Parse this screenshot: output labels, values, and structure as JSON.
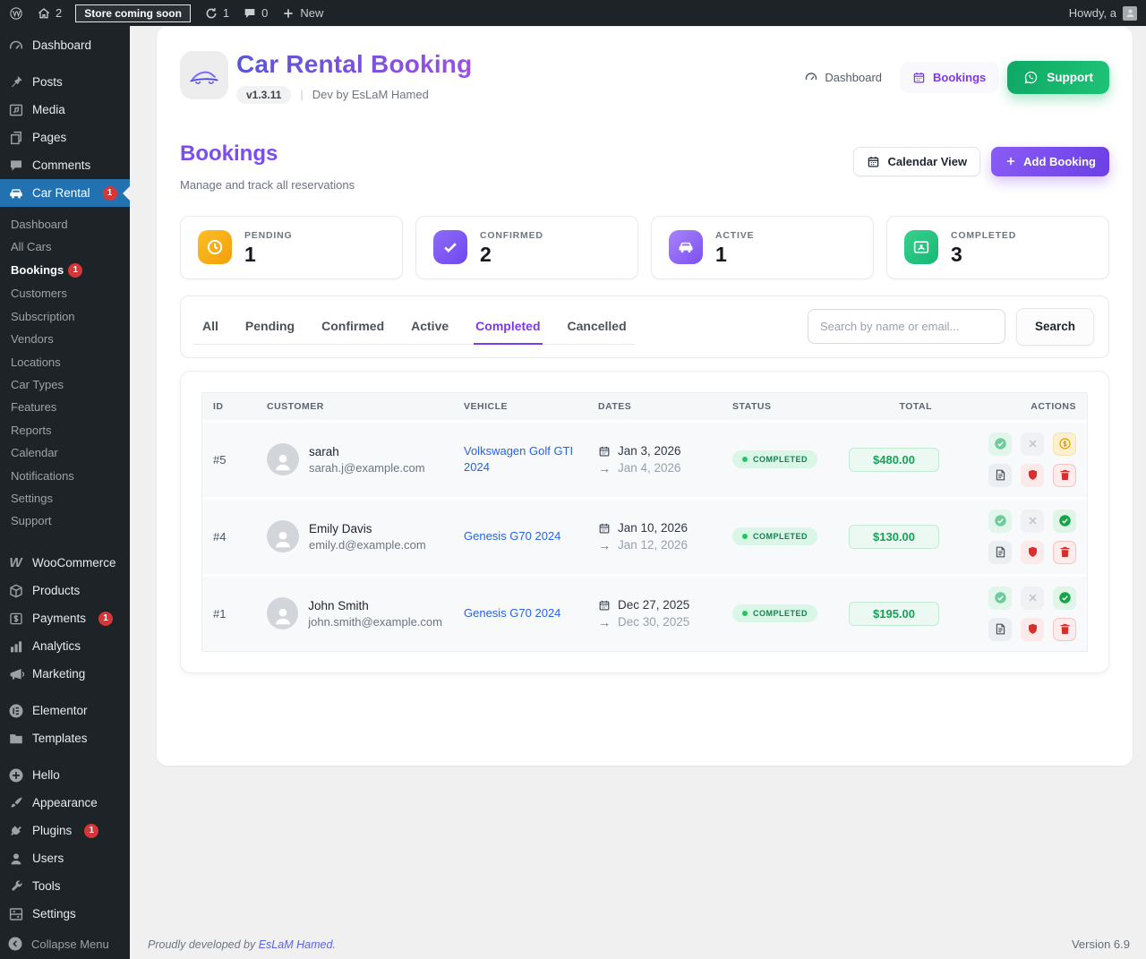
{
  "colors": {
    "accent_purple": "#7c3aed",
    "accent_green": "#12b76a",
    "wp_active_blue": "#2271b1",
    "badge_red": "#d63638",
    "status_completed_bg": "#d9f6e6",
    "status_completed_text": "#178050"
  },
  "admin_bar": {
    "home_count": "2",
    "site_status": "Store coming soon",
    "updates_count": "1",
    "comments_count": "0",
    "new_label": "New",
    "greeting": "Howdy, a"
  },
  "sidebar": {
    "items": [
      {
        "label": "Dashboard",
        "icon": "dashboard-icon"
      },
      {
        "label": "Posts",
        "icon": "pushpin-icon",
        "gap_before": true
      },
      {
        "label": "Media",
        "icon": "media-icon"
      },
      {
        "label": "Pages",
        "icon": "pages-icon"
      },
      {
        "label": "Comments",
        "icon": "comment-icon"
      },
      {
        "label": "Car Rental",
        "icon": "car-icon",
        "badge": "1",
        "active": true,
        "submenu": [
          {
            "label": "Dashboard"
          },
          {
            "label": "All Cars"
          },
          {
            "label": "Bookings",
            "badge": "1",
            "active": true
          },
          {
            "label": "Customers"
          },
          {
            "label": "Subscription"
          },
          {
            "label": "Vendors"
          },
          {
            "label": "Locations"
          },
          {
            "label": "Car Types"
          },
          {
            "label": "Features"
          },
          {
            "label": "Reports"
          },
          {
            "label": "Calendar"
          },
          {
            "label": "Notifications"
          },
          {
            "label": "Settings"
          },
          {
            "label": "Support"
          }
        ]
      },
      {
        "label": "WooCommerce",
        "icon": "woocommerce-icon",
        "gap_before": true
      },
      {
        "label": "Products",
        "icon": "products-icon"
      },
      {
        "label": "Payments",
        "icon": "payments-icon",
        "badge": "1"
      },
      {
        "label": "Analytics",
        "icon": "analytics-icon"
      },
      {
        "label": "Marketing",
        "icon": "marketing-icon"
      },
      {
        "label": "Elementor",
        "icon": "elementor-icon",
        "gap_before": true
      },
      {
        "label": "Templates",
        "icon": "templates-icon"
      },
      {
        "label": "Hello",
        "icon": "hello-icon",
        "gap_before": true
      },
      {
        "label": "Appearance",
        "icon": "appearance-icon"
      },
      {
        "label": "Plugins",
        "icon": "plugins-icon",
        "badge": "1"
      },
      {
        "label": "Users",
        "icon": "users-icon"
      },
      {
        "label": "Tools",
        "icon": "tools-icon"
      },
      {
        "label": "Settings",
        "icon": "settings-icon"
      }
    ],
    "collapse": {
      "label": "Collapse Menu",
      "icon": "collapse-icon"
    }
  },
  "header": {
    "title": "Car Rental Booking",
    "version": "v1.3.11",
    "divider": "|",
    "credit": "Dev by EsLaM Hamed",
    "nav_dashboard": "Dashboard",
    "nav_bookings": "Bookings",
    "nav_support": "Support",
    "logo_icon": "car-doodle-icon"
  },
  "bookings": {
    "title": "Bookings",
    "subtitle": "Manage and track all reservations",
    "calendar_view": "Calendar View",
    "add_booking": "Add Booking"
  },
  "stats": [
    {
      "label": "PENDING",
      "value": "1",
      "icon": "clock-icon",
      "color_from": "#fbbf24",
      "color_to": "#f59e0b"
    },
    {
      "label": "CONFIRMED",
      "value": "2",
      "icon": "check-icon",
      "color_from": "#8d6bf8",
      "color_to": "#7147ee"
    },
    {
      "label": "ACTIVE",
      "value": "1",
      "icon": "car-icon",
      "color_from": "#a784fa",
      "color_to": "#7c4ff2"
    },
    {
      "label": "COMPLETED",
      "value": "3",
      "icon": "id-card-icon",
      "color_from": "#3ad08f",
      "color_to": "#14b873"
    }
  ],
  "filters": {
    "tabs": [
      "All",
      "Pending",
      "Confirmed",
      "Active",
      "Completed",
      "Cancelled"
    ],
    "active_tab": "Completed",
    "search_placeholder": "Search by name or email...",
    "search_button": "Search"
  },
  "table": {
    "headers": [
      "ID",
      "CUSTOMER",
      "VEHICLE",
      "DATES",
      "STATUS",
      "TOTAL",
      "ACTIONS"
    ],
    "rows": [
      {
        "id": "#5",
        "customer_name": "sarah",
        "customer_email": "sarah.j@example.com",
        "vehicle": "Volkswagen Golf GTI 2024",
        "date_start": "Jan 3, 2026",
        "date_end": "Jan 4, 2026",
        "status": "COMPLETED",
        "total": "$480.00",
        "actions": [
          {
            "icon": "check-circle-icon",
            "variant": "green-soft"
          },
          {
            "icon": "x-icon",
            "variant": "gray"
          },
          {
            "icon": "dollar-icon",
            "variant": "amber"
          },
          {
            "icon": "invoice-icon",
            "variant": "slate"
          },
          {
            "icon": "shield-icon",
            "variant": "red"
          },
          {
            "icon": "trash-icon",
            "variant": "red-outline"
          }
        ]
      },
      {
        "id": "#4",
        "customer_name": "Emily Davis",
        "customer_email": "emily.d@example.com",
        "vehicle": "Genesis G70 2024",
        "date_start": "Jan 10, 2026",
        "date_end": "Jan 12, 2026",
        "status": "COMPLETED",
        "total": "$130.00",
        "actions": [
          {
            "icon": "check-circle-icon",
            "variant": "green-soft"
          },
          {
            "icon": "x-icon",
            "variant": "gray"
          },
          {
            "icon": "check-circle-icon",
            "variant": "green-solid"
          },
          {
            "icon": "invoice-icon",
            "variant": "slate"
          },
          {
            "icon": "shield-icon",
            "variant": "red"
          },
          {
            "icon": "trash-icon",
            "variant": "red-outline"
          }
        ]
      },
      {
        "id": "#1",
        "customer_name": "John Smith",
        "customer_email": "john.smith@example.com",
        "vehicle": "Genesis G70 2024",
        "date_start": "Dec 27, 2025",
        "date_end": "Dec 30, 2025",
        "status": "COMPLETED",
        "total": "$195.00",
        "actions": [
          {
            "icon": "check-circle-icon",
            "variant": "green-soft"
          },
          {
            "icon": "x-icon",
            "variant": "gray"
          },
          {
            "icon": "check-circle-icon",
            "variant": "green-solid"
          },
          {
            "icon": "invoice-icon",
            "variant": "slate"
          },
          {
            "icon": "shield-icon",
            "variant": "red"
          },
          {
            "icon": "trash-icon",
            "variant": "red-outline"
          }
        ]
      }
    ]
  },
  "footer": {
    "credit_prefix": "Proudly developed by",
    "credit_link": "EsLaM Hamed",
    "credit_suffix": ".",
    "version": "Version 6.9"
  }
}
